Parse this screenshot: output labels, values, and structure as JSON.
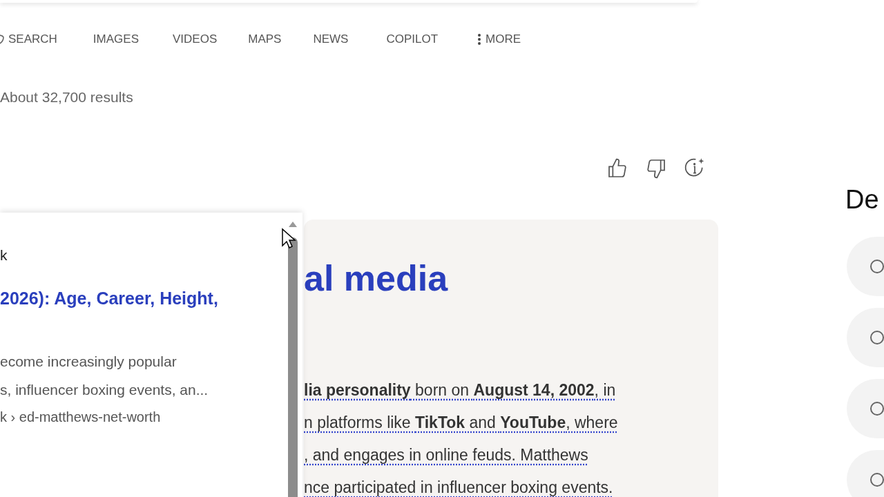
{
  "nav": [
    {
      "label": "SEARCH",
      "kind": "search"
    },
    {
      "label": "IMAGES",
      "kind": "plain"
    },
    {
      "label": "VIDEOS",
      "kind": "plain"
    },
    {
      "label": "MAPS",
      "kind": "plain"
    },
    {
      "label": "NEWS",
      "kind": "plain"
    },
    {
      "label": "COPILOT",
      "kind": "plain"
    },
    {
      "label": "MORE",
      "kind": "more"
    }
  ],
  "results_count": "About 32,700 results",
  "answer": {
    "title": "al media",
    "lines": [
      "**lia personality** born on **August 14, 2002**, in",
      "n platforms like **TikTok** and **YouTube**, where",
      ", and engages in online feuds. Matthews",
      "nce participated in influencer boxing events."
    ]
  },
  "popup": {
    "source": "k",
    "title": "2026): Age, Career, Height,",
    "snippet": [
      "ecome increasingly popular",
      "s, influencer boxing events, an..."
    ],
    "url": "k › ed-matthews-net-worth"
  },
  "sidebar": {
    "heading": "De",
    "options": [
      {
        "kind": "radio",
        "checked": false
      },
      {
        "kind": "radio",
        "checked": false
      },
      {
        "kind": "radio",
        "checked": false
      },
      {
        "kind": "radio",
        "checked": false
      }
    ]
  }
}
